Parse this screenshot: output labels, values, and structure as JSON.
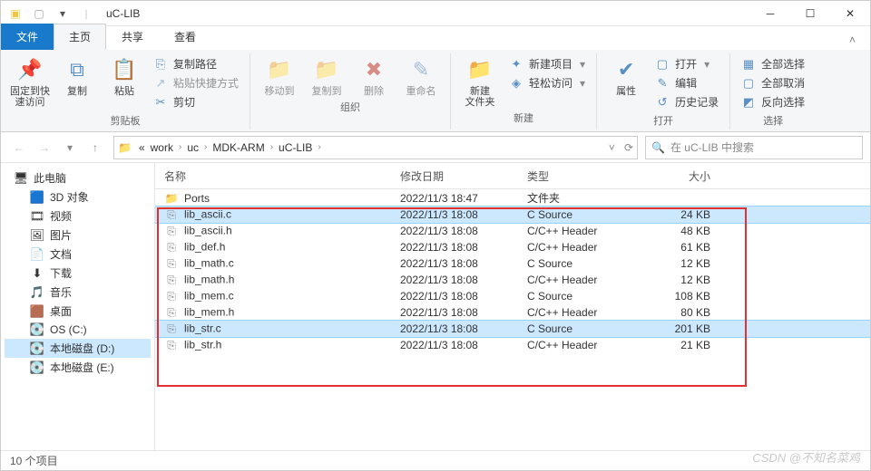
{
  "window": {
    "title": "uC-LIB"
  },
  "qat": {
    "back_enabled": false
  },
  "tabs": {
    "file": "文件",
    "items": [
      "主页",
      "共享",
      "查看"
    ],
    "active": 0
  },
  "ribbon": {
    "groups": {
      "clipboard": {
        "label": "剪贴板",
        "pin": "固定到快\n速访问",
        "copy": "复制",
        "paste": "粘贴",
        "copy_path": "复制路径",
        "paste_shortcut": "粘贴快捷方式",
        "cut": "剪切"
      },
      "organize": {
        "label": "组织",
        "move_to": "移动到",
        "copy_to": "复制到",
        "delete": "删除",
        "rename": "重命名"
      },
      "new": {
        "label": "新建",
        "new_folder": "新建\n文件夹",
        "new_item": "新建项目",
        "easy_access": "轻松访问"
      },
      "open": {
        "label": "打开",
        "properties": "属性",
        "open": "打开",
        "edit": "编辑",
        "history": "历史记录"
      },
      "select": {
        "label": "选择",
        "select_all": "全部选择",
        "select_none": "全部取消",
        "invert": "反向选择"
      }
    }
  },
  "breadcrumb": {
    "prefix": "«",
    "segments": [
      "work",
      "uc",
      "MDK-ARM",
      "uC-LIB"
    ]
  },
  "search": {
    "placeholder": "在 uC-LIB 中搜索"
  },
  "sidebar": {
    "nodes": [
      {
        "label": "此电脑",
        "icon": "pc",
        "indent": false
      },
      {
        "label": "3D 对象",
        "icon": "3d",
        "indent": true
      },
      {
        "label": "视频",
        "icon": "video",
        "indent": true
      },
      {
        "label": "图片",
        "icon": "pic",
        "indent": true
      },
      {
        "label": "文档",
        "icon": "doc",
        "indent": true
      },
      {
        "label": "下载",
        "icon": "dl",
        "indent": true
      },
      {
        "label": "音乐",
        "icon": "music",
        "indent": true
      },
      {
        "label": "桌面",
        "icon": "desk",
        "indent": true
      },
      {
        "label": "OS (C:)",
        "icon": "drive",
        "indent": true
      },
      {
        "label": "本地磁盘 (D:)",
        "icon": "drive",
        "indent": true,
        "selected": true
      },
      {
        "label": "本地磁盘 (E:)",
        "icon": "drive",
        "indent": true
      }
    ]
  },
  "columns": {
    "name": "名称",
    "date": "修改日期",
    "type": "类型",
    "size": "大小"
  },
  "files": [
    {
      "name": "Ports",
      "date": "2022/11/3 18:47",
      "type": "文件夹",
      "size": "",
      "icon": "folder"
    },
    {
      "name": "lib_ascii.c",
      "date": "2022/11/3 18:08",
      "type": "C Source",
      "size": "24 KB",
      "icon": "c",
      "selected": true
    },
    {
      "name": "lib_ascii.h",
      "date": "2022/11/3 18:08",
      "type": "C/C++ Header",
      "size": "48 KB",
      "icon": "h"
    },
    {
      "name": "lib_def.h",
      "date": "2022/11/3 18:08",
      "type": "C/C++ Header",
      "size": "61 KB",
      "icon": "h"
    },
    {
      "name": "lib_math.c",
      "date": "2022/11/3 18:08",
      "type": "C Source",
      "size": "12 KB",
      "icon": "c"
    },
    {
      "name": "lib_math.h",
      "date": "2022/11/3 18:08",
      "type": "C/C++ Header",
      "size": "12 KB",
      "icon": "h"
    },
    {
      "name": "lib_mem.c",
      "date": "2022/11/3 18:08",
      "type": "C Source",
      "size": "108 KB",
      "icon": "c"
    },
    {
      "name": "lib_mem.h",
      "date": "2022/11/3 18:08",
      "type": "C/C++ Header",
      "size": "80 KB",
      "icon": "h"
    },
    {
      "name": "lib_str.c",
      "date": "2022/11/3 18:08",
      "type": "C Source",
      "size": "201 KB",
      "icon": "c",
      "selected": true
    },
    {
      "name": "lib_str.h",
      "date": "2022/11/3 18:08",
      "type": "C/C++ Header",
      "size": "21 KB",
      "icon": "h"
    }
  ],
  "status": {
    "count": "10 个项目"
  },
  "watermark": "CSDN @不知名菜鸡"
}
